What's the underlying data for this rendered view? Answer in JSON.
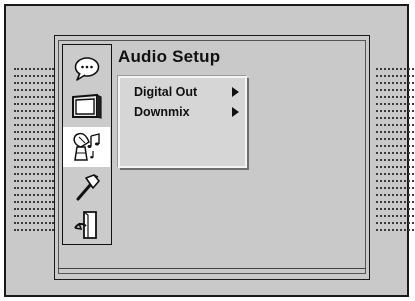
{
  "menu": {
    "title": "Audio Setup",
    "items": [
      {
        "label": "Digital Out"
      },
      {
        "label": "Downmix"
      }
    ]
  },
  "icon_bar": {
    "icons": [
      "speech-bubble-icon",
      "tv-screen-icon",
      "speaker-music-icon",
      "hammer-wrench-icon",
      "exit-door-icon"
    ],
    "selected": "speaker-music-icon"
  }
}
